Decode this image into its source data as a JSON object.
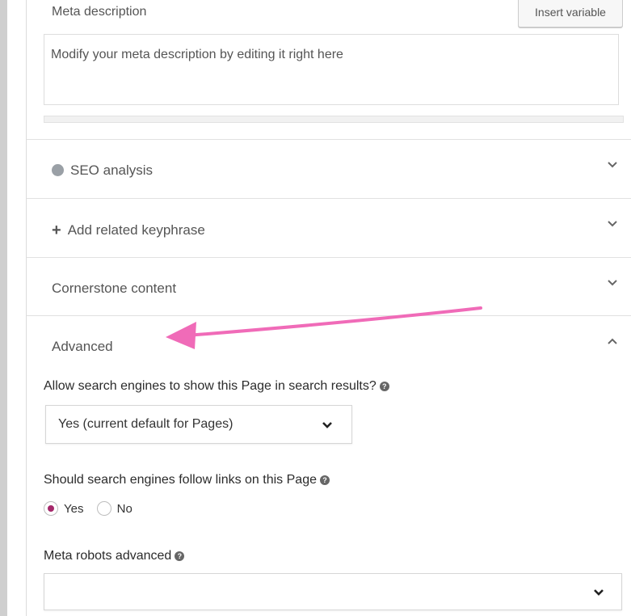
{
  "meta_description": {
    "label": "Meta description",
    "insert_button": "Insert variable",
    "placeholder": "Modify your meta description by editing it right here"
  },
  "sections": {
    "seo_analysis": "SEO analysis",
    "related_keyphrase": "Add related keyphrase",
    "cornerstone": "Cornerstone content",
    "advanced": "Advanced"
  },
  "advanced": {
    "show_in_results_question": "Allow search engines to show this Page in search results?",
    "show_in_results_value": "Yes (current default for Pages)",
    "follow_links_question": "Should search engines follow links on this Page",
    "follow_yes": "Yes",
    "follow_no": "No",
    "follow_selected": "Yes",
    "robots_label": "Meta robots advanced",
    "robots_value": ""
  },
  "colors": {
    "accent": "#a4286a",
    "annotation_arrow": "#f06bb8",
    "seo_dot": "#9aa0a6"
  },
  "icons": {
    "help": "question-circle-icon",
    "chevron_down": "chevron-down-icon",
    "chevron_up": "chevron-up-icon",
    "plus": "plus-icon",
    "status_dot": "status-dot-icon"
  }
}
